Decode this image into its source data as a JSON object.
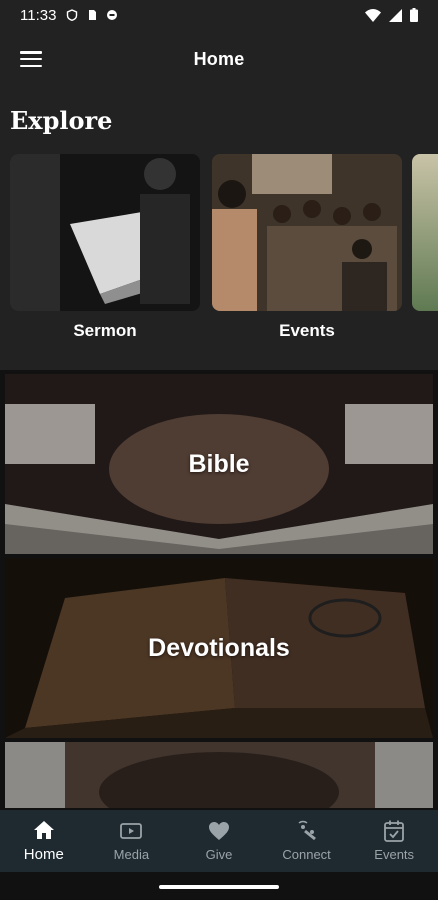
{
  "status_bar": {
    "time": "11:33",
    "left_icons": [
      "shield-icon",
      "sim-card-icon",
      "vpn-icon"
    ],
    "right_icons": [
      "wifi-icon",
      "signal-icon",
      "battery-icon"
    ]
  },
  "app_bar": {
    "title": "Home",
    "menu_icon": "hamburger-icon"
  },
  "explore": {
    "title": "Explore",
    "cards": [
      {
        "label": "Sermon"
      },
      {
        "label": "Events"
      }
    ]
  },
  "tiles": [
    {
      "label": "Bible"
    },
    {
      "label": "Devotionals"
    },
    {
      "label": ""
    }
  ],
  "bottom_nav": {
    "active": "Home",
    "items": [
      {
        "label": "Home",
        "icon": "home-icon"
      },
      {
        "label": "Media",
        "icon": "video-camera-icon"
      },
      {
        "label": "Give",
        "icon": "heart-icon"
      },
      {
        "label": "Connect",
        "icon": "connect-icon"
      },
      {
        "label": "Events",
        "icon": "calendar-check-icon"
      }
    ]
  },
  "colors": {
    "background": "#222222",
    "bottom_nav": "#1e2a30",
    "nav_inactive": "#9aa3a8",
    "text": "#ffffff"
  }
}
